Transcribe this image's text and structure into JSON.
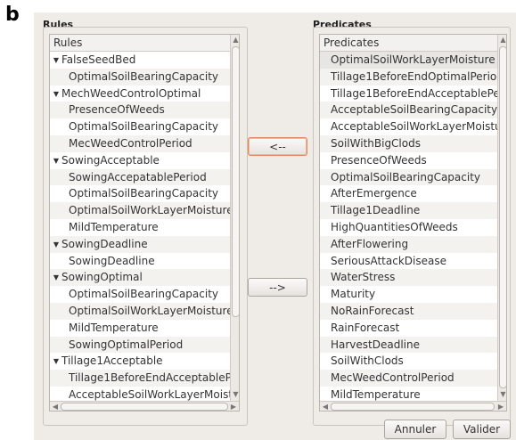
{
  "figure_label": "b",
  "rules": {
    "group_title": "Rules",
    "header": "Rules",
    "items": [
      {
        "text": "FalseSeedBed",
        "parent": true
      },
      {
        "text": "OptimalSoilBearingCapacity",
        "parent": false
      },
      {
        "text": "MechWeedControlOptimal",
        "parent": true
      },
      {
        "text": "PresenceOfWeeds",
        "parent": false
      },
      {
        "text": "OptimalSoilBearingCapacity",
        "parent": false
      },
      {
        "text": "MecWeedControlPeriod",
        "parent": false
      },
      {
        "text": "SowingAcceptable",
        "parent": true
      },
      {
        "text": "SowingAccepatablePeriod",
        "parent": false
      },
      {
        "text": "OptimalSoilBearingCapacity",
        "parent": false
      },
      {
        "text": "OptimalSoilWorkLayerMoisture",
        "parent": false
      },
      {
        "text": "MildTemperature",
        "parent": false
      },
      {
        "text": "SowingDeadline",
        "parent": true
      },
      {
        "text": "SowingDeadline",
        "parent": false
      },
      {
        "text": "SowingOptimal",
        "parent": true
      },
      {
        "text": "OptimalSoilBearingCapacity",
        "parent": false
      },
      {
        "text": "OptimalSoilWorkLayerMoisture",
        "parent": false
      },
      {
        "text": "MildTemperature",
        "parent": false
      },
      {
        "text": "SowingOptimalPeriod",
        "parent": false
      },
      {
        "text": "Tillage1Acceptable",
        "parent": true
      },
      {
        "text": "Tillage1BeforeEndAcceptableP",
        "parent": false
      },
      {
        "text": "AcceptableSoilWorkLayerMoist",
        "parent": false
      }
    ]
  },
  "predicates": {
    "group_title": "Predicates",
    "header": "Predicates",
    "selected_index": 0,
    "items": [
      "OptimalSoilWorkLayerMoisture",
      "Tillage1BeforeEndOptimalPerioc",
      "Tillage1BeforeEndAcceptablePe",
      "AcceptableSoilBearingCapacity",
      "AcceptableSoilWorkLayerMoistur",
      "SoilWithBigClods",
      "PresenceOfWeeds",
      "OptimalSoilBearingCapacity",
      "AfterEmergence",
      "Tillage1Deadline",
      "HighQuantitiesOfWeeds",
      "AfterFlowering",
      "SeriousAttackDisease",
      "WaterStress",
      "Maturity",
      "NoRainForecast",
      "RainForecast",
      "HarvestDeadline",
      "SoilWithClods",
      "MecWeedControlPeriod",
      "MildTemperature"
    ]
  },
  "buttons": {
    "move_left": "<--",
    "move_right": "-->",
    "cancel": "Annuler",
    "validate": "Valider"
  },
  "scroll": {
    "rules_vertical": 0.0,
    "predicates_vertical": 0.0
  }
}
